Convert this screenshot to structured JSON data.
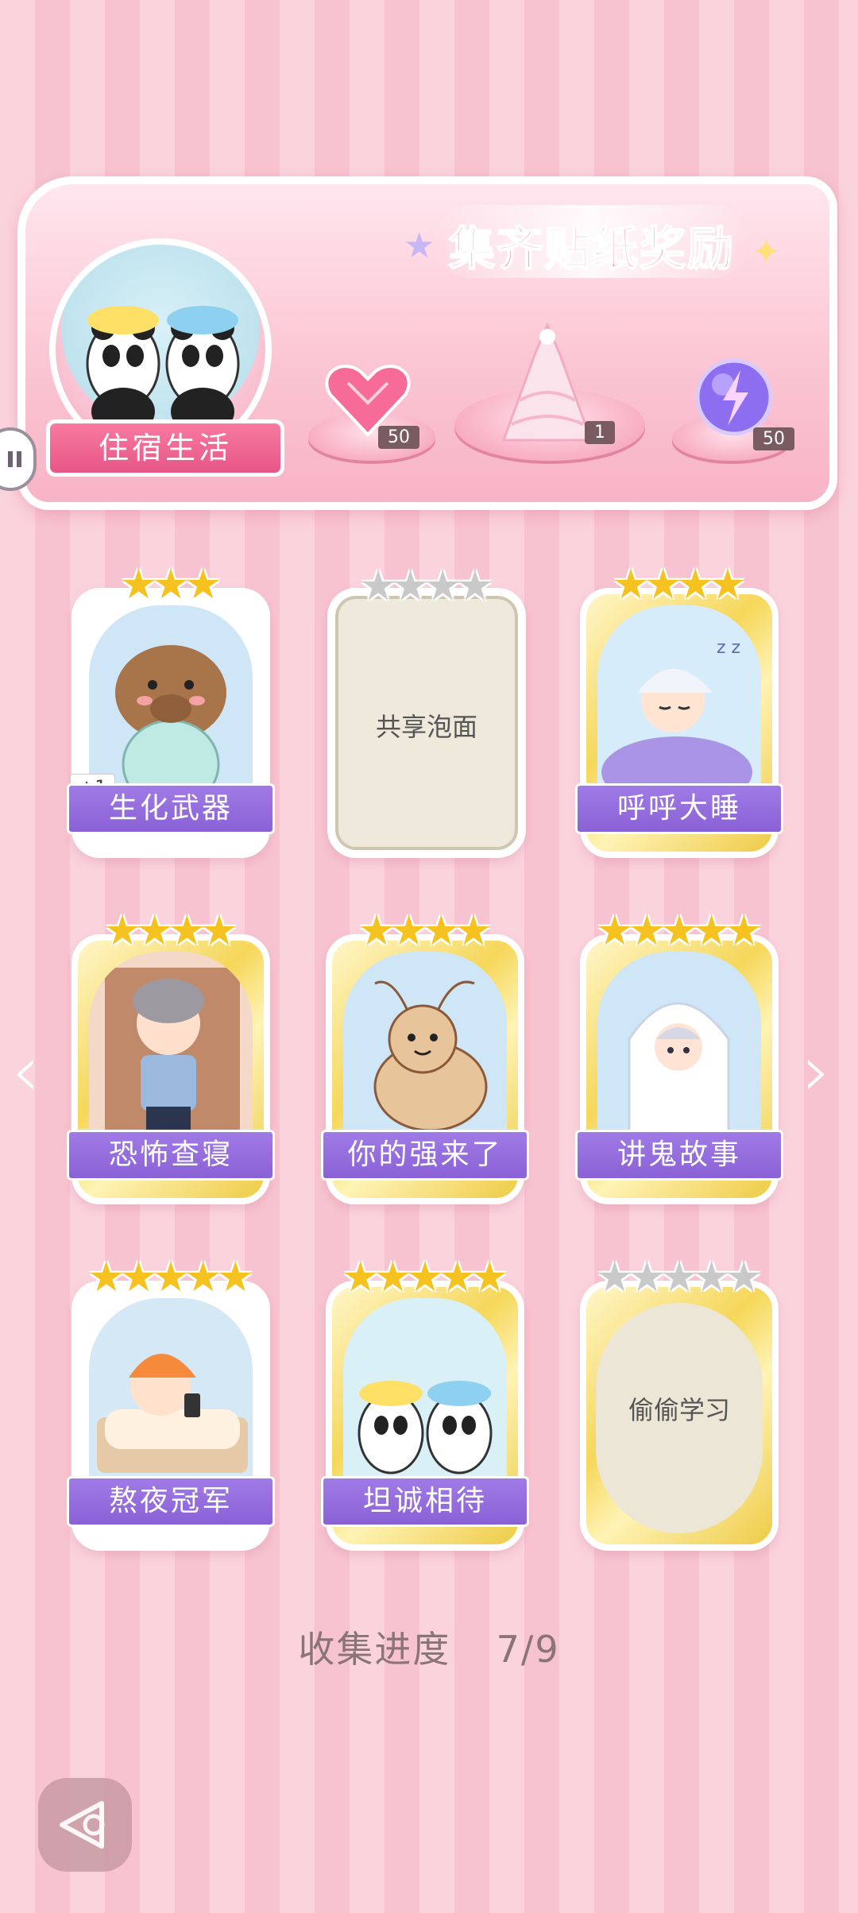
{
  "banner": {
    "title": "集齐贴纸奖励",
    "theme_label": "住宿生活",
    "rewards": [
      {
        "icon": "pink-heart-gem-icon",
        "count": "50"
      },
      {
        "icon": "dress-outfit-icon",
        "count": "1"
      },
      {
        "icon": "energy-orb-icon",
        "count": "50"
      }
    ]
  },
  "cards": [
    {
      "name": "生化武器",
      "stars": 3,
      "max_stars": 3,
      "state": "collected",
      "badge": "+1"
    },
    {
      "name": "共享泡面",
      "stars": 0,
      "max_stars": 4,
      "state": "locked"
    },
    {
      "name": "呼呼大睡",
      "stars": 4,
      "max_stars": 4,
      "state": "collected"
    },
    {
      "name": "恐怖查寝",
      "stars": 4,
      "max_stars": 4,
      "state": "collected"
    },
    {
      "name": "你的强来了",
      "stars": 4,
      "max_stars": 4,
      "state": "collected"
    },
    {
      "name": "讲鬼故事",
      "stars": 5,
      "max_stars": 5,
      "state": "collected"
    },
    {
      "name": "熬夜冠军",
      "stars": 5,
      "max_stars": 5,
      "state": "collected"
    },
    {
      "name": "坦诚相待",
      "stars": 5,
      "max_stars": 5,
      "state": "collected"
    },
    {
      "name": "偷偷学习",
      "stars": 0,
      "max_stars": 5,
      "state": "locked"
    }
  ],
  "progress": {
    "label": "收集进度",
    "value": "7/9"
  },
  "colors": {
    "accent_pink": "#ff6f9c",
    "label_purple": "#8a61d6",
    "star_gold": "#f6c21f"
  }
}
